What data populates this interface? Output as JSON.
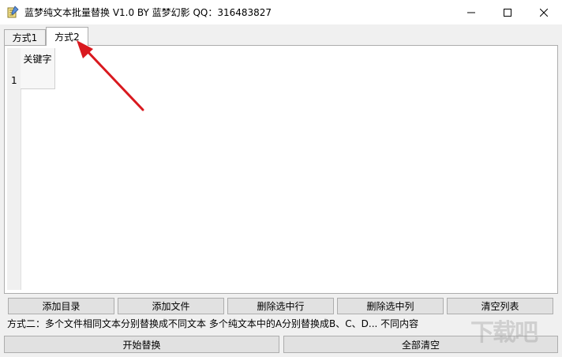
{
  "window": {
    "title": "蓝梦纯文本批量替换 V1.0 BY 蓝梦幻影 QQ：316483827",
    "icon": "notepad-icon",
    "controls": {
      "minimize": "minimize-icon",
      "maximize": "maximize-icon",
      "close": "close-icon"
    }
  },
  "tabs": [
    {
      "label": "方式1",
      "active": false
    },
    {
      "label": "方式2",
      "active": true
    }
  ],
  "grid": {
    "columns": [
      "关键字"
    ],
    "rows": [
      "1"
    ]
  },
  "buttons": {
    "add_directory": "添加目录",
    "add_file": "添加文件",
    "delete_row": "删除选中行",
    "delete_column": "删除选中列",
    "clear_list": "清空列表",
    "start_replace": "开始替换",
    "clear_all": "全部清空"
  },
  "description": "方式二：多个文件相同文本分别替换成不同文本  多个纯文本中的A分别替换成B、C、D... 不同内容",
  "watermark": "下载吧",
  "colors": {
    "annotation_arrow": "#d9191f",
    "panel_bg": "#ffffff",
    "window_bg": "#f0f0f0"
  }
}
